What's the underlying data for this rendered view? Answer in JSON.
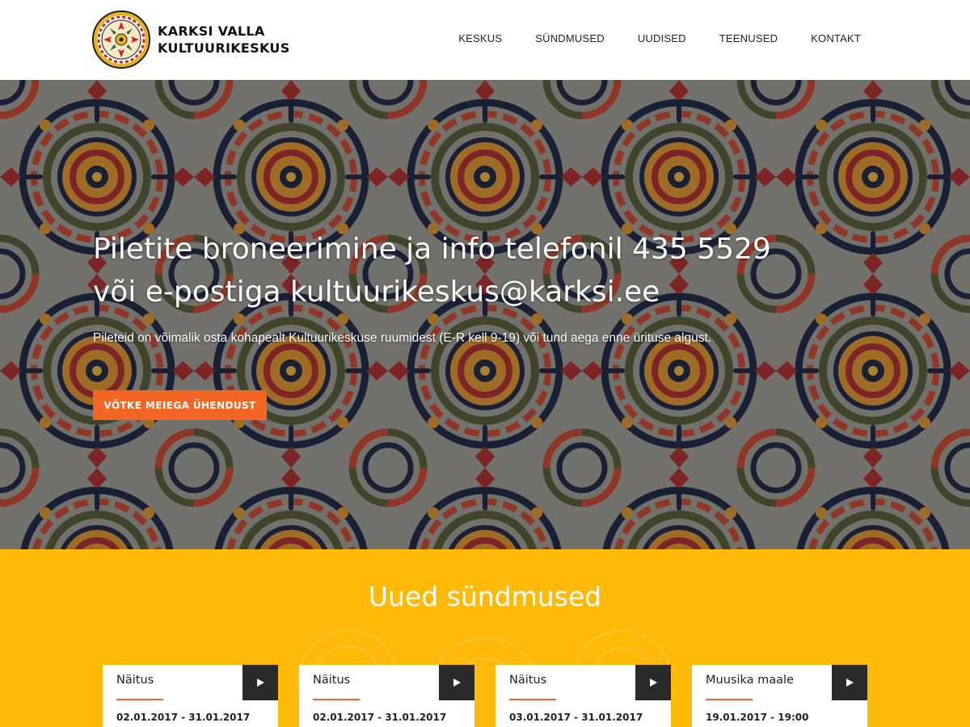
{
  "header": {
    "logo": {
      "line1": "KARKSI VALLA",
      "line2": "KULTUURIKESKUS",
      "emblem_text": "KARKSI VALLA KULTUURIKESKUS"
    },
    "nav": [
      {
        "label": "KESKUS"
      },
      {
        "label": "SÜNDMUSED"
      },
      {
        "label": "UUDISED"
      },
      {
        "label": "TEENUSED"
      },
      {
        "label": "KONTAKT"
      }
    ]
  },
  "hero": {
    "title_line1": "Piletite broneerimine ja info telefonil 435 5529",
    "title_line2": "või e-postiga kultuurikeskus@karksi.ee",
    "subtitle": "Pileteid on võimalik osta kohapealt Kultuurikeskuse ruumidest (E-R kell 9-19) või tund aega enne ürituse algust.",
    "button_label": "VÕTKE MEIEGA ÜHENDUST"
  },
  "events": {
    "title": "Uued sündmused",
    "cards": [
      {
        "title": "Näitus",
        "date": "02.01.2017 - 31.01.2017",
        "icon": "play-icon"
      },
      {
        "title": "Näitus",
        "date": "02.01.2017 - 31.01.2017",
        "icon": "play-icon"
      },
      {
        "title": "Näitus",
        "date": "03.01.2017 - 31.01.2017",
        "icon": "play-icon"
      },
      {
        "title": "Muusika maale",
        "date": "19.01.2017 - 19:00",
        "icon": "play-icon"
      }
    ]
  },
  "colors": {
    "accent": "#f26522",
    "events_background": "#ffb909",
    "play_button": "#2a2a2a",
    "hero_overlay": "#3e3c38"
  }
}
